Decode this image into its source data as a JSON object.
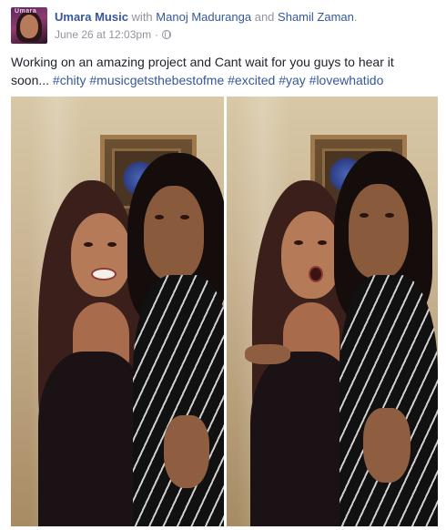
{
  "post": {
    "author": "Umara Music",
    "with_word": "with",
    "tagged_1": "Manoj Maduranga",
    "and_word": "and",
    "tagged_2": "Shamil Zaman",
    "period": ".",
    "timestamp": "June 26 at 12:03pm",
    "separator": "·",
    "privacy_icon": "globe-icon",
    "text": "Working on an amazing project and Cant wait for you guys to hear it soon...",
    "hashtags": [
      "#chity",
      "#musicgetsthebestofme",
      "#excited",
      "#yay",
      "#lovewhatido"
    ]
  },
  "avatar": {
    "label": "Umara"
  },
  "colors": {
    "link": "#365899",
    "meta": "#90949c",
    "text": "#1d2129"
  }
}
